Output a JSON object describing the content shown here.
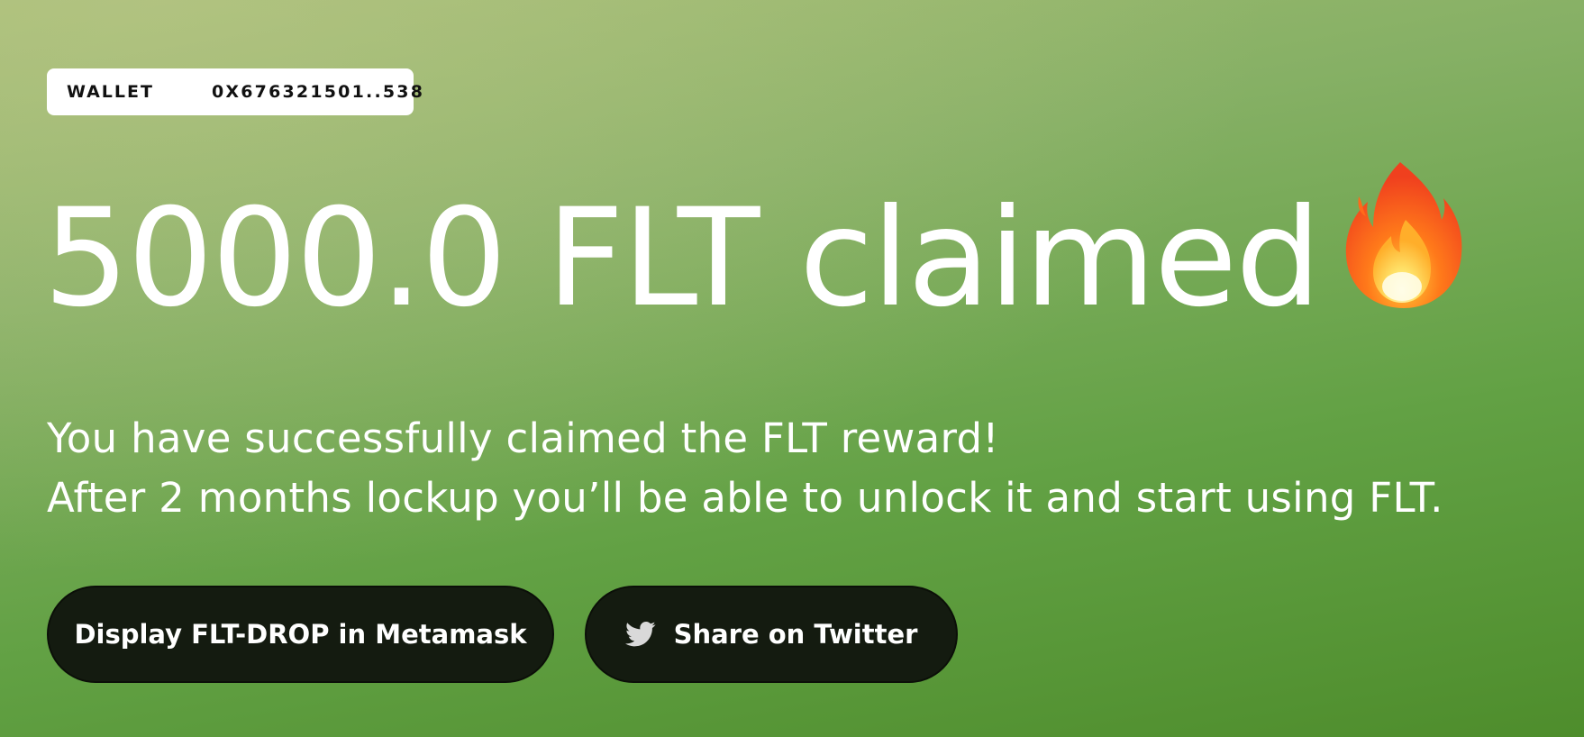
{
  "wallet": {
    "label": "WALLET",
    "address": "0X676321501..538"
  },
  "headline": {
    "text": "5000.0 FLT claimed",
    "icon": "fire-icon"
  },
  "message": {
    "line1": "You have successfully claimed the FLT reward!",
    "line2": "After 2 months lockup you’ll be able to unlock it and start using FLT."
  },
  "actions": {
    "metamask_label": "Display FLT-DROP in Metamask",
    "twitter_label": "Share on Twitter",
    "twitter_icon": "twitter-bird-icon"
  },
  "colors": {
    "button_bg": "#141b10",
    "text": "#ffffff"
  }
}
